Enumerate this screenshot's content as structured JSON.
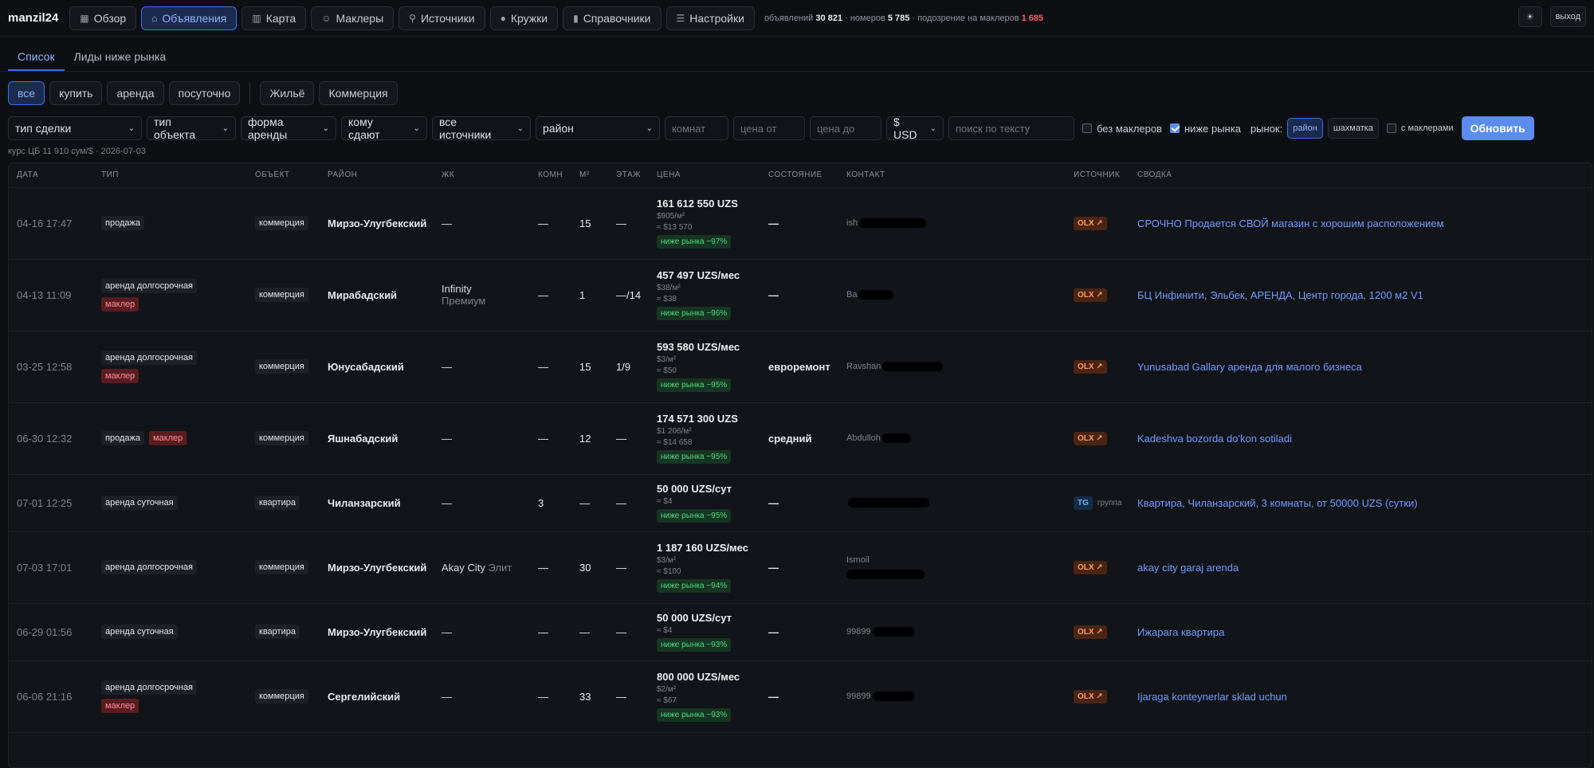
{
  "brand": "manzil24",
  "nav": [
    {
      "label": "Обзор",
      "icon": "grid-icon",
      "glyph": "▦",
      "active": false
    },
    {
      "label": "Объявления",
      "icon": "home-icon",
      "glyph": "⌂",
      "active": true
    },
    {
      "label": "Карта",
      "icon": "map-icon",
      "glyph": "▥",
      "active": false
    },
    {
      "label": "Маклеры",
      "icon": "users-icon",
      "glyph": "☺",
      "active": false
    },
    {
      "label": "Источники",
      "icon": "rss-icon",
      "glyph": "⚲",
      "active": false
    },
    {
      "label": "Кружки",
      "icon": "mic-icon",
      "glyph": "●",
      "active": false
    },
    {
      "label": "Справочники",
      "icon": "library-icon",
      "glyph": "▮",
      "active": false
    },
    {
      "label": "Настройки",
      "icon": "settings-icon",
      "glyph": "☰",
      "active": false
    }
  ],
  "stats": {
    "listings_label": "объявлений",
    "listings": "30 821",
    "numbers_label": "· номеров",
    "numbers": "5 785",
    "suspect_label": "· подозрение на маклеров",
    "suspect": "1 685"
  },
  "header_right": {
    "theme_icon": "☀",
    "logout": "выход"
  },
  "subtabs": [
    "Список",
    "Лиды ниже рынка"
  ],
  "chips": {
    "deal": [
      "все",
      "купить",
      "аренда",
      "посуточно"
    ],
    "kind": [
      "Жильё",
      "Коммерция"
    ]
  },
  "filters": {
    "deal_type": "тип сделки",
    "object_type": "тип объекта",
    "rent_form": "форма аренды",
    "rent_to": "кому сдают",
    "sources": "все источники",
    "district": "район",
    "rooms_ph": "комнат",
    "price_from_ph": "цена от",
    "price_to_ph": "цена до",
    "currency": "$ USD",
    "search_ph": "поиск по тексту",
    "no_brokers": "без маклеров",
    "below_market": "ниже рынка",
    "market_label": "рынок:",
    "market_district": "район",
    "market_chess": "шахматка",
    "with_brokers": "с маклерами",
    "refresh": "Обновить"
  },
  "rate": "курс ЦБ 11 910 сум/$ · 2026-07-03",
  "columns": [
    "ДАТА",
    "ТИП",
    "ОБЪЕКТ",
    "РАЙОН",
    "ЖК",
    "КОМН",
    "М²",
    "ЭТАЖ",
    "ЦЕНА",
    "СОСТОЯНИЕ",
    "КОНТАКТ",
    "ИСТОЧНИК",
    "СВОДКА"
  ],
  "rows": [
    {
      "date": "04-16 17:47",
      "type": "продажа",
      "broker": "",
      "object": "коммерция",
      "district": "Мирзо-Улугбекский",
      "zk": "—",
      "zk_class": "",
      "rooms": "—",
      "area": "15",
      "floor": "—",
      "price": "161 612 550 UZS",
      "per_m": "$905/м²",
      "usd": "≈ $13 570",
      "below": "ниже рынка −97%",
      "state": "—",
      "contact": "ish",
      "source": "OLX ↗",
      "source_type": "olx",
      "source_note": "",
      "summary": "СРОЧНО Продается СВОЙ магазин с хорошим расположением"
    },
    {
      "date": "04-13 11:09",
      "type": "аренда долгосрочная",
      "broker": "маклер",
      "object": "коммерция",
      "district": "Мирабадский",
      "zk": "Infinity",
      "zk_class": "Премиум",
      "rooms": "—",
      "area": "1",
      "floor": "—/14",
      "price": "457 497 UZS/мес",
      "per_m": "$38/м²",
      "usd": "≈ $38",
      "below": "ниже рынка −96%",
      "state": "—",
      "contact": "Ba",
      "source": "OLX ↗",
      "source_type": "olx",
      "source_note": "",
      "summary": "БЦ Инфинити, Эльбек, АРЕНДА, Центр города, 1200 м2 V1"
    },
    {
      "date": "03-25 12:58",
      "type": "аренда долгосрочная",
      "broker": "маклер",
      "object": "коммерция",
      "district": "Юнусабадский",
      "zk": "—",
      "zk_class": "",
      "rooms": "—",
      "area": "15",
      "floor": "1/9",
      "price": "593 580 UZS/мес",
      "per_m": "$3/м²",
      "usd": "≈ $50",
      "below": "ниже рынка −95%",
      "state": "евроремонт",
      "contact": "Ravshan",
      "source": "OLX ↗",
      "source_type": "olx",
      "source_note": "",
      "summary": "Yunusabad Gallary аренда для малого бизнеса"
    },
    {
      "date": "06-30 12:32",
      "type": "продажа",
      "broker": "маклер",
      "object": "коммерция",
      "district": "Яшнабадский",
      "zk": "—",
      "zk_class": "",
      "rooms": "—",
      "area": "12",
      "floor": "—",
      "price": "174 571 300 UZS",
      "per_m": "$1 206/м²",
      "usd": "≈ $14 658",
      "below": "ниже рынка −95%",
      "state": "средний",
      "contact": "Abdulloh",
      "source": "OLX ↗",
      "source_type": "olx",
      "source_note": "",
      "summary": "Kadeshva bozorda do'kon sotiladi"
    },
    {
      "date": "07-01 12:25",
      "type": "аренда суточная",
      "broker": "",
      "object": "квартира",
      "district": "Чиланзарский",
      "zk": "—",
      "zk_class": "",
      "rooms": "3",
      "area": "—",
      "floor": "—",
      "price": "50 000 UZS/сут",
      "per_m": "",
      "usd": "≈ $4",
      "below": "ниже рынка −95%",
      "state": "—",
      "contact": "",
      "source": "TG",
      "source_type": "tg",
      "source_note": "группа",
      "summary": "Квартира, Чиланзарский, 3 комнаты, от 50000 UZS (сутки)"
    },
    {
      "date": "07-03 17:01",
      "type": "аренда долгосрочная",
      "broker": "",
      "object": "коммерция",
      "district": "Мирзо-Улугбекский",
      "zk": "Akay City",
      "zk_class": "Элит",
      "rooms": "—",
      "area": "30",
      "floor": "—",
      "price": "1 187 160 UZS/мес",
      "per_m": "$3/м²",
      "usd": "≈ $100",
      "below": "ниже рынка −94%",
      "state": "—",
      "contact": "Ismoil",
      "source": "OLX ↗",
      "source_type": "olx",
      "source_note": "",
      "summary": "akay city garaj arenda"
    },
    {
      "date": "06-29 01:56",
      "type": "аренда суточная",
      "broker": "",
      "object": "квартира",
      "district": "Мирзо-Улугбекский",
      "zk": "—",
      "zk_class": "",
      "rooms": "—",
      "area": "—",
      "floor": "—",
      "price": "50 000 UZS/сут",
      "per_m": "",
      "usd": "≈ $4",
      "below": "ниже рынка −93%",
      "state": "—",
      "contact": "99899",
      "source": "OLX ↗",
      "source_type": "olx",
      "source_note": "",
      "summary": "Ижарага квартира"
    },
    {
      "date": "06-06 21:16",
      "type": "аренда долгосрочная",
      "broker": "маклер",
      "object": "коммерция",
      "district": "Сергелийский",
      "zk": "—",
      "zk_class": "",
      "rooms": "—",
      "area": "33",
      "floor": "—",
      "price": "800 000 UZS/мес",
      "per_m": "$2/м²",
      "usd": "≈ $67",
      "below": "ниже рынка −93%",
      "state": "—",
      "contact": "99899",
      "source": "OLX ↗",
      "source_type": "olx",
      "source_note": "",
      "summary": "Ijaraga konteynerlar sklad uchun"
    }
  ]
}
